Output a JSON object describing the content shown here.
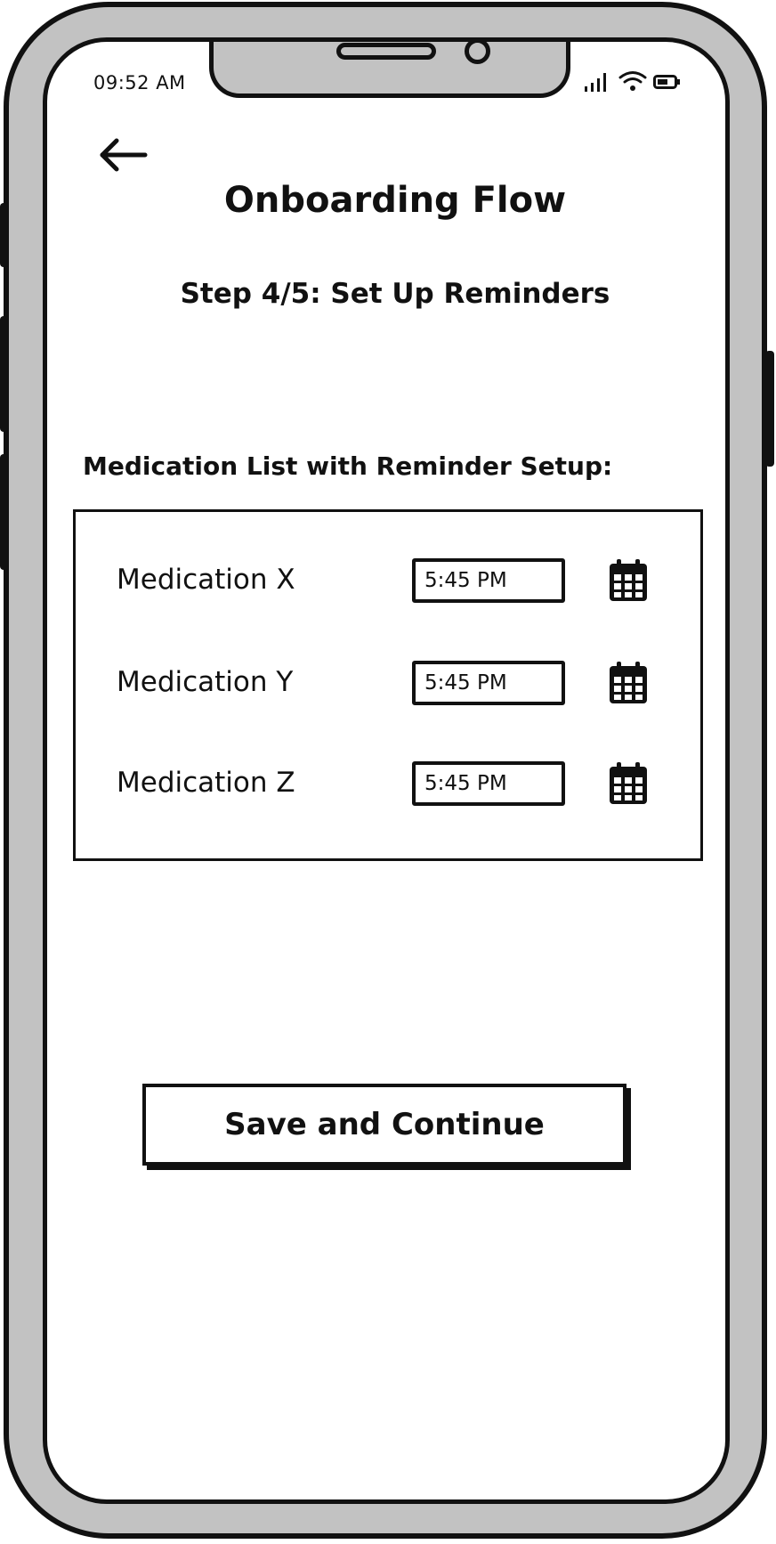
{
  "status_bar": {
    "time": "09:52 AM",
    "icons": [
      "signal-icon",
      "wifi-icon",
      "battery-icon"
    ]
  },
  "header": {
    "back_icon": "arrow-left-icon",
    "title": "Onboarding Flow",
    "step": "Step 4/5: Set Up Reminders"
  },
  "medications": {
    "section_label": "Medication List with Reminder Setup:",
    "items": [
      {
        "name": "Medication X",
        "time": "5:45 PM",
        "icon": "calendar-icon"
      },
      {
        "name": "Medication Y",
        "time": "5:45 PM",
        "icon": "calendar-icon"
      },
      {
        "name": "Medication Z",
        "time": "5:45 PM",
        "icon": "calendar-icon"
      }
    ]
  },
  "actions": {
    "save_label": "Save and Continue"
  },
  "colors": {
    "frame": "#c2c2c2",
    "ink": "#111111",
    "screen": "#ffffff"
  }
}
